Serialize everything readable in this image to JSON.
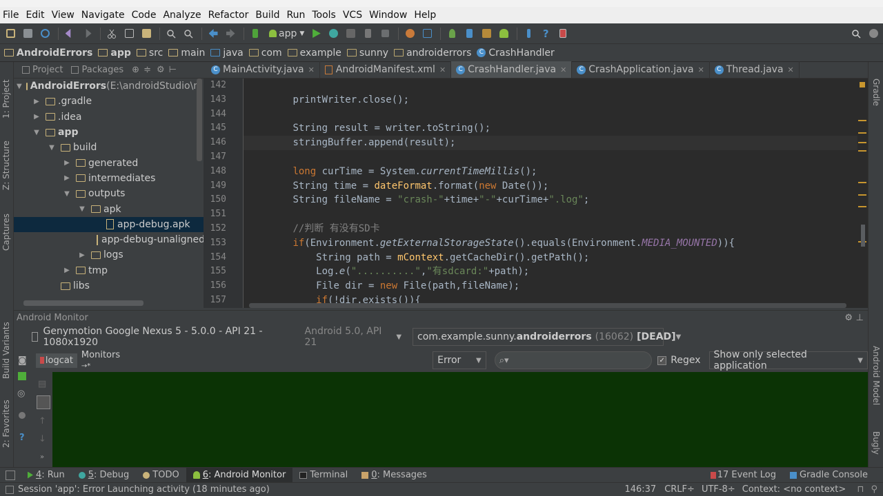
{
  "menu": [
    "File",
    "Edit",
    "View",
    "Navigate",
    "Code",
    "Analyze",
    "Refactor",
    "Build",
    "Run",
    "Tools",
    "VCS",
    "Window",
    "Help"
  ],
  "toolbar": {
    "run_config": "app"
  },
  "breadcrumbs": [
    "AndroidErrors",
    "app",
    "src",
    "main",
    "java",
    "com",
    "example",
    "sunny",
    "androiderrors",
    "CrashHandler"
  ],
  "left_strip": {
    "project": "1: Project",
    "structure": "Z: Structure",
    "captures": "Captures",
    "build_variants": "Build Variants",
    "favorites": "2: Favorites"
  },
  "right_strip": {
    "gradle": "Gradle",
    "android_model": "Android Model",
    "bugly": "Bugly"
  },
  "project_panel": {
    "tab_project": "Project",
    "tab_packages": "Packages"
  },
  "tree": [
    {
      "label": "AndroidErrors",
      "suffix": " (E:\\androidStudio\\muk",
      "indent": 0,
      "arrow": "▼",
      "icon": "folder",
      "bold": true
    },
    {
      "label": ".gradle",
      "indent": 1,
      "arrow": "▶",
      "icon": "folder"
    },
    {
      "label": ".idea",
      "indent": 1,
      "arrow": "▶",
      "icon": "folder"
    },
    {
      "label": "app",
      "indent": 1,
      "arrow": "▼",
      "icon": "folder",
      "bold": true
    },
    {
      "label": "build",
      "indent": 2,
      "arrow": "▼",
      "icon": "folder"
    },
    {
      "label": "generated",
      "indent": 3,
      "arrow": "▶",
      "icon": "folder"
    },
    {
      "label": "intermediates",
      "indent": 3,
      "arrow": "▶",
      "icon": "folder"
    },
    {
      "label": "outputs",
      "indent": 3,
      "arrow": "▼",
      "icon": "folder"
    },
    {
      "label": "apk",
      "indent": 4,
      "arrow": "▼",
      "icon": "folder"
    },
    {
      "label": "app-debug.apk",
      "indent": 5,
      "arrow": "",
      "icon": "apk",
      "selected": true
    },
    {
      "label": "app-debug-unaligned.",
      "indent": 5,
      "arrow": "",
      "icon": "apk"
    },
    {
      "label": "logs",
      "indent": 4,
      "arrow": "▶",
      "icon": "folder"
    },
    {
      "label": "tmp",
      "indent": 3,
      "arrow": "▶",
      "icon": "folder"
    },
    {
      "label": "libs",
      "indent": 2,
      "arrow": "",
      "icon": "folder"
    }
  ],
  "editor_tabs": [
    {
      "label": "MainActivity.java",
      "icon": "class"
    },
    {
      "label": "AndroidManifest.xml",
      "icon": "xml"
    },
    {
      "label": "CrashHandler.java",
      "icon": "class",
      "active": true
    },
    {
      "label": "CrashApplication.java",
      "icon": "class"
    },
    {
      "label": "Thread.java",
      "icon": "class"
    }
  ],
  "line_numbers": [
    "142",
    "143",
    "144",
    "145",
    "146",
    "147",
    "148",
    "149",
    "150",
    "151",
    "152",
    "153",
    "154",
    "155",
    "156",
    "157"
  ],
  "code": {
    "l143": "printWriter.close();",
    "l145_a": "String result = writer.toString();",
    "l146": "stringBuffer.append(result);",
    "l148_kw": "long",
    "l148_a": " curTime = System.",
    "l148_it": "currentTimeMillis",
    "l148_b": "();",
    "l149_a": "String time = ",
    "l149_fn": "dateFormat",
    "l149_b": ".format(",
    "l149_kw": "new",
    "l149_c": " Date());",
    "l150_a": "String fileName = ",
    "l150_s1": "\"crash-\"",
    "l150_b": "+time+",
    "l150_s2": "\"-\"",
    "l150_c": "+curTime+",
    "l150_s3": "\".log\"",
    "l150_d": ";",
    "l152": "//判断 有没有SD卡",
    "l153_kw": "if",
    "l153_a": "(Environment.",
    "l153_it": "getExternalStorageState",
    "l153_b": "().equals(Environment.",
    "l153_cn": "MEDIA_MOUNTED",
    "l153_c": ")){",
    "l154_a": "String path = ",
    "l154_fn": "mContext",
    "l154_b": ".getCacheDir().getPath();",
    "l155_a": "Log.",
    "l155_it": "e",
    "l155_b": "(",
    "l155_s1": "\"..........\"",
    "l155_c": ",",
    "l155_s2": "\"有sdcard:\"",
    "l155_d": "+path);",
    "l156_a": "File dir = ",
    "l156_kw": "new",
    "l156_b": " File(path,fileName);",
    "l157_kw": "if",
    "l157_a": "(!dir.exists()){"
  },
  "android_monitor": {
    "title": "Android Monitor",
    "device": "Genymotion Google Nexus 5 - 5.0.0 - API 21 - 1080x1920",
    "device_sub": "Android 5.0, API 21",
    "process_prefix": "com.example.sunny.",
    "process_bold": "androiderrors",
    "process_pid": "(16062)",
    "process_state": "[DEAD]",
    "tab_logcat": "logcat",
    "tab_monitors": "Monitors",
    "log_level": "Error",
    "search_placeholder": "",
    "regex_label": "Regex",
    "filter": "Show only selected application"
  },
  "bottom_tabs": [
    {
      "num": "4",
      "label": ": Run"
    },
    {
      "num": "5",
      "label": ": Debug"
    },
    {
      "num": "",
      "label": "TODO"
    },
    {
      "num": "6",
      "label": ": Android Monitor",
      "active": true
    },
    {
      "num": "",
      "label": "Terminal"
    },
    {
      "num": "0",
      "label": ": Messages"
    }
  ],
  "right_tabs": {
    "event_log": "17 Event Log",
    "gradle_console": "Gradle Console"
  },
  "status": {
    "message": "Session 'app': Error Launching activity (18 minutes ago)",
    "position": "146:37",
    "line_sep": "CRLF",
    "encoding": "UTF-8",
    "context": "Context: <no context>"
  }
}
